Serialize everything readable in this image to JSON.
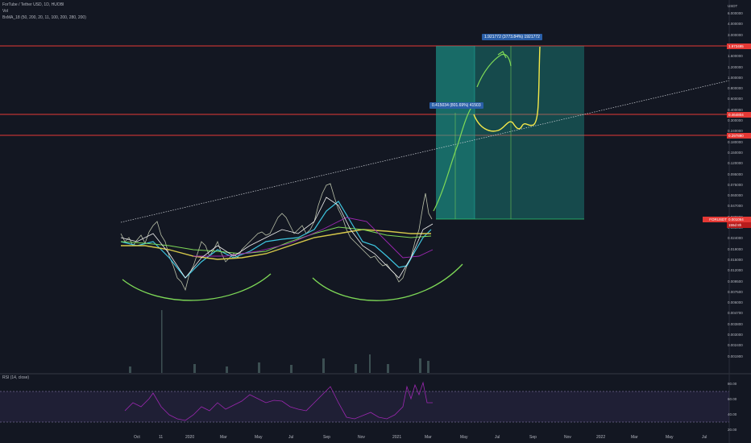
{
  "legend": {
    "title": "ForTube / Tether USD, 1D, HUOBI",
    "vol": "Vol",
    "ma": "BxMA_18 (50, 200, 20, 11, 100, 200, 280, 200)",
    "rsi": "RSI (14, close)"
  },
  "price_axis": {
    "currency": "USDT",
    "ticks": [
      "6.000000",
      "4.000000",
      "3.000000",
      "2.000000",
      "1.600000",
      "1.200000",
      "1.000000",
      "0.800000",
      "0.600000",
      "0.400000",
      "0.300000",
      "0.240000",
      "0.180000",
      "0.150000",
      "0.120000",
      "0.095000",
      "0.075000",
      "0.060000",
      "0.047000",
      "0.038000",
      "0.030000",
      "0.024000",
      "0.019000",
      "0.015000",
      "0.012000",
      "0.009500",
      "0.007500",
      "0.006000",
      "0.004700",
      "0.003800",
      "0.003000",
      "0.002400",
      "0.001900"
    ]
  },
  "levels": {
    "top": "1.973495",
    "mid": "0.464804",
    "low": "0.297890",
    "current": "0.001064",
    "current_sub": "FORUSDT",
    "current_time": "155d 8h"
  },
  "tags": {
    "big": "1.921772 (3773.84%) 1921772",
    "small": "0.415034 (801.69%) 41503"
  },
  "rsi_ticks": [
    "80.00",
    "60.00",
    "40.00",
    "20.00"
  ],
  "x_ticks": [
    "Oct",
    "11",
    "2020",
    "Mar",
    "May",
    "Jul",
    "Sep",
    "Nov",
    "2021",
    "Mar",
    "May",
    "Jul",
    "Sep",
    "Nov",
    "2022",
    "Mar",
    "May",
    "Jul"
  ],
  "colors": {
    "background": "#131722",
    "level": "#e53935",
    "box": "#1ea99a",
    "drawing_green": "#7ed957",
    "drawing_yellow": "#f5e94a",
    "rsi": "#9c27b0"
  }
}
